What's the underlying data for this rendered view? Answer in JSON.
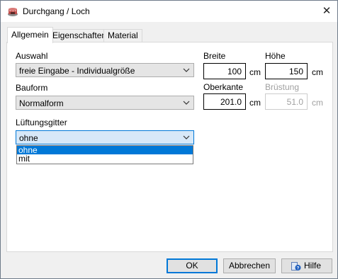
{
  "window": {
    "title": "Durchgang / Loch",
    "close_glyph": "✕"
  },
  "tabs": [
    {
      "label": "Allgemein",
      "active": true
    },
    {
      "label": "Eigenschaften",
      "active": false
    },
    {
      "label": "Material",
      "active": false
    }
  ],
  "general": {
    "auswahl": {
      "label": "Auswahl",
      "value": "freie Eingabe - Individualgröße"
    },
    "bauform": {
      "label": "Bauform",
      "value": "Normalform"
    },
    "lueftungsgitter": {
      "label": "Lüftungsgitter",
      "value": "ohne",
      "options": [
        "ohne",
        "mit"
      ],
      "selected_index": 0
    }
  },
  "dimensions": {
    "breite": {
      "label": "Breite",
      "value": "100",
      "unit": "cm"
    },
    "hoehe": {
      "label": "Höhe",
      "value": "150",
      "unit": "cm"
    },
    "oberkante": {
      "label": "Oberkante",
      "value": "201.0",
      "unit": "cm"
    },
    "bruestung": {
      "label": "Brüstung",
      "value": "51.0",
      "unit": "cm",
      "disabled": true
    }
  },
  "buttons": {
    "ok": "OK",
    "abbrechen": "Abbrechen",
    "hilfe": "Hilfe"
  },
  "icons": {
    "app": "hole-in-wall-icon",
    "close": "close-icon",
    "dropdown": "chevron-down-icon",
    "help": "help-book-icon"
  },
  "colors": {
    "accent": "#0078d7",
    "selection": "#0078d7",
    "disabled_text": "#a0a0a0"
  }
}
